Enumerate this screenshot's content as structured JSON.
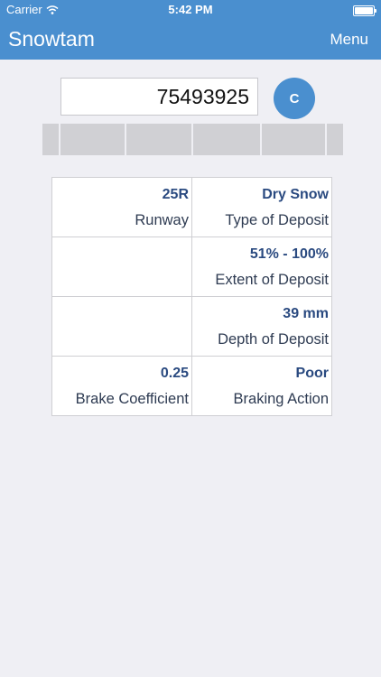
{
  "status_bar": {
    "carrier": "Carrier",
    "time": "5:42 PM"
  },
  "header": {
    "title": "Snowtam",
    "menu_label": "Menu"
  },
  "input": {
    "value": "75493925"
  },
  "clear_button": {
    "label": "C"
  },
  "results": [
    [
      {
        "value": "25R",
        "label": "Runway"
      },
      {
        "value": "Dry Snow",
        "label": "Type of Deposit"
      }
    ],
    [
      {
        "value": "",
        "label": ""
      },
      {
        "value": "51% - 100%",
        "label": "Extent of Deposit"
      }
    ],
    [
      {
        "value": "",
        "label": ""
      },
      {
        "value": "39 mm",
        "label": "Depth of Deposit"
      }
    ],
    [
      {
        "value": "0.25",
        "label": "Brake Coefficient"
      },
      {
        "value": "Poor",
        "label": "Braking Action"
      }
    ]
  ]
}
